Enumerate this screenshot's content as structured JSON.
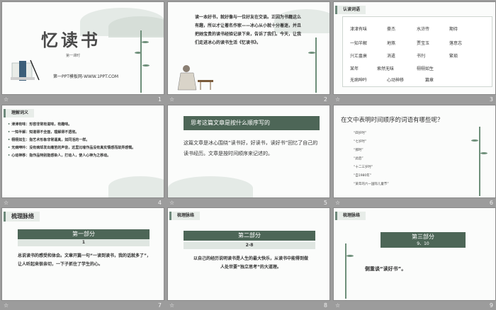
{
  "slides": [
    {
      "title": "忆读书",
      "subtitle": "第一课时",
      "brand": "第一PPT模板网-WWW.1PPT.COM",
      "number": "1"
    },
    {
      "body": "读一本好书，就好像与一位好友在交谈。正因为书籍这么有趣，所以才让著名作家——冰心从小就十分着迷，并且把她宝贵的读书经验记录下来，告诉了我们。今天，让我们走进冰心的读书生活《忆读书》。",
      "number": "2"
    },
    {
      "tag": "认读词语",
      "words": [
        "津津有味",
        "豪杰",
        "水浒传",
        "期待",
        "一知半解",
        "地煞",
        "贾宝玉",
        "落意志",
        "兴汇盎衰",
        "消遣",
        "书刊",
        "繁琐",
        "某年",
        "索然无味",
        "栩栩如生",
        "无病呻吟",
        "心动神移",
        "篇章"
      ],
      "number": "3"
    },
    {
      "tag": "理解词义",
      "items": [
        "津津有味：形容非常有滋味，有趣味。",
        "一知半解：知道得不全面，理解得不透彻。",
        "栩栩如生：指艺术形象非常逼真，如同活的一样。",
        "无病呻吟：没有病却发出痛苦的声音，这里比喻作品没有真实情感而故弄感慨。",
        "心动神移：指作品特别能感染人，打动人，使人心神为之移动。"
      ],
      "number": "4"
    },
    {
      "question": "思考这篇文章是按什么顺序写的",
      "answer": "这篇文章是冰心围绕“读书好，好读书，读好书”回忆了自己的读书经历。文章是按时间顺序来记述的。",
      "number": "5"
    },
    {
      "title": "在文中表明时间顺序的词语有哪些呢？",
      "items": [
        "“四岁时”",
        "“七岁时”",
        "“那时”",
        "“此后”",
        "“十二三岁时”",
        "“自1980年”",
        "“某年的六一国际儿童节”"
      ],
      "number": "6"
    },
    {
      "tag": "梳理脉络",
      "part": "第一部分",
      "sub": "1",
      "body": "总说读书的感受和体会。文章开篇一句“一读到读书，我的话就多了”，让人听起来很亲切，一下子抓住了学生的心。",
      "number": "7"
    },
    {
      "tag": "梳理脉络",
      "part": "第二部分",
      "sub": "2-8",
      "body": "以自己的经历说明读书是人生的最大快乐，从读书中能得到做人处世要“独立思考”的大道理。",
      "number": "8"
    },
    {
      "tag": "梳理脉络",
      "part": "第三部分",
      "sub": "9、10",
      "body": "侧重谈“读好书”。",
      "number": "9"
    }
  ],
  "caption_icon": "☆",
  "colors": {
    "accent": "#4d6657",
    "band_light": "#dfe6e1"
  }
}
